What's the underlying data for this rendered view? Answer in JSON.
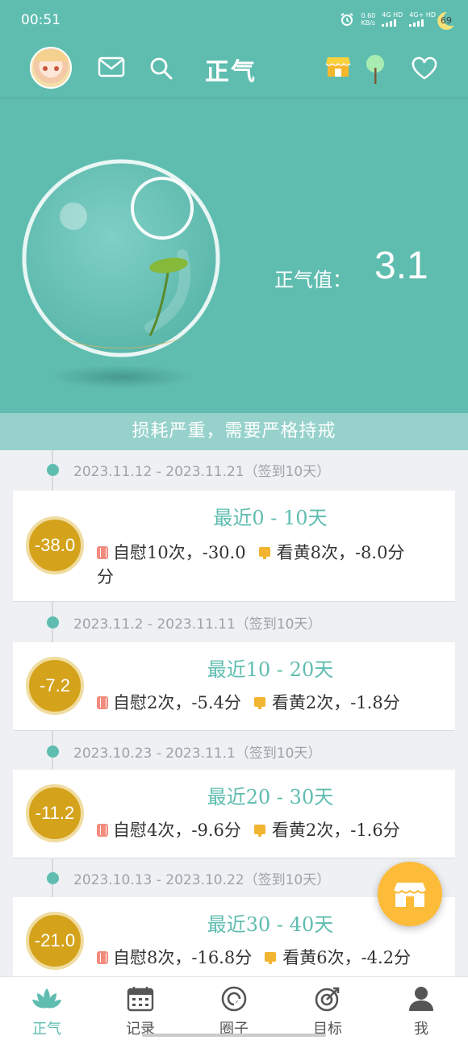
{
  "status_bar": {
    "time": "00:51",
    "net_speed_value": "0.60",
    "net_speed_unit": "KB/s",
    "sim1": "4G HD",
    "sim2": "4G+ HD",
    "battery": "69"
  },
  "header": {
    "title": "正气",
    "icons": [
      "avatar",
      "mail-icon",
      "search-icon",
      "shop-icon",
      "tree-icon",
      "heart-icon"
    ]
  },
  "hero": {
    "score_label": "正气值：",
    "score_value": "3.1",
    "status_message": "损耗严重，需要严格持戒"
  },
  "periods": [
    {
      "range": "2023.11.12 - 2023.11.21（签到10天）",
      "score": "-38.0",
      "title": "最近0 - 10天",
      "masturbation": "自慰10次，-30.0",
      "porn": "看黄8次，-8.0分",
      "wrap": "分"
    },
    {
      "range": "2023.11.2 - 2023.11.11（签到10天）",
      "score": "-7.2",
      "title": "最近10 - 20天",
      "masturbation": "自慰2次，-5.4分",
      "porn": "看黄2次，-1.8分",
      "wrap": ""
    },
    {
      "range": "2023.10.23 - 2023.11.1（签到10天）",
      "score": "-11.2",
      "title": "最近20 - 30天",
      "masturbation": "自慰4次，-9.6分",
      "porn": "看黄2次，-1.6分",
      "wrap": ""
    },
    {
      "range": "2023.10.13 - 2023.10.22（签到10天）",
      "score": "-21.0",
      "title": "最近30 - 40天",
      "masturbation": "自慰8次，-16.8分",
      "porn": "看黄6次，-4.2分",
      "wrap": ""
    }
  ],
  "tabs": [
    {
      "label": "正气",
      "icon": "lotus-icon",
      "active": true
    },
    {
      "label": "记录",
      "icon": "calendar-icon",
      "active": false
    },
    {
      "label": "圈子",
      "icon": "circle-icon",
      "active": false
    },
    {
      "label": "目标",
      "icon": "target-icon",
      "active": false
    },
    {
      "label": "我",
      "icon": "person-icon",
      "active": false
    }
  ],
  "colors": {
    "brand": "#5fbdb0",
    "banner": "#96d2cb",
    "medal": "#d4a21b",
    "fab": "#fdbb3a"
  }
}
